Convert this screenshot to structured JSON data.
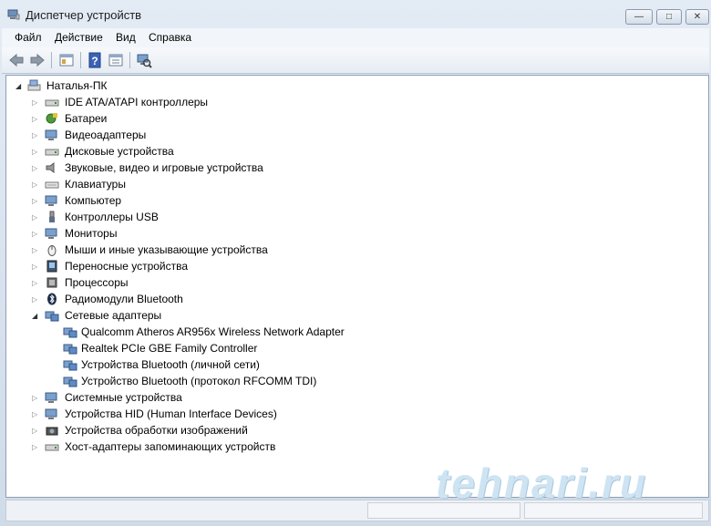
{
  "window": {
    "title": "Диспетчер устройств"
  },
  "caption_buttons": {
    "minimize": "—",
    "maximize": "□",
    "close": "✕"
  },
  "menu": [
    "Файл",
    "Действие",
    "Вид",
    "Справка"
  ],
  "toolbar": {
    "icons": [
      "back-icon",
      "forward-icon",
      "properties-icon",
      "help-icon",
      "details-icon",
      "scan-hardware-icon"
    ]
  },
  "tree": {
    "root": "Наталья-ПК",
    "categories": [
      {
        "label": "IDE ATA/ATAPI контроллеры",
        "icon": "ide-controller-icon"
      },
      {
        "label": "Батареи",
        "icon": "battery-icon"
      },
      {
        "label": "Видеоадаптеры",
        "icon": "display-adapter-icon"
      },
      {
        "label": "Дисковые устройства",
        "icon": "disk-drive-icon"
      },
      {
        "label": "Звуковые, видео и игровые устройства",
        "icon": "speaker-icon"
      },
      {
        "label": "Клавиатуры",
        "icon": "keyboard-icon"
      },
      {
        "label": "Компьютер",
        "icon": "computer-icon"
      },
      {
        "label": "Контроллеры USB",
        "icon": "usb-icon"
      },
      {
        "label": "Мониторы",
        "icon": "monitor-icon"
      },
      {
        "label": "Мыши и иные указывающие устройства",
        "icon": "mouse-icon"
      },
      {
        "label": "Переносные устройства",
        "icon": "portable-device-icon"
      },
      {
        "label": "Процессоры",
        "icon": "processor-icon"
      },
      {
        "label": "Радиомодули Bluetooth",
        "icon": "bluetooth-icon"
      },
      {
        "label": "Сетевые адаптеры",
        "icon": "network-adapter-icon",
        "expanded": true,
        "children": [
          "Qualcomm Atheros AR956x Wireless Network Adapter",
          "Realtek PCIe GBE Family Controller",
          "Устройства Bluetooth (личной сети)",
          "Устройство Bluetooth (протокол RFCOMM TDI)"
        ]
      },
      {
        "label": "Системные устройства",
        "icon": "system-device-icon"
      },
      {
        "label": "Устройства HID (Human Interface Devices)",
        "icon": "hid-icon"
      },
      {
        "label": "Устройства обработки изображений",
        "icon": "imaging-device-icon"
      },
      {
        "label": "Хост-адаптеры запоминающих устройств",
        "icon": "storage-controller-icon"
      }
    ]
  },
  "watermark": "tehnari.ru",
  "colors": {
    "accent": "#2b5ea8",
    "tree_border": "#8e9fb4"
  }
}
